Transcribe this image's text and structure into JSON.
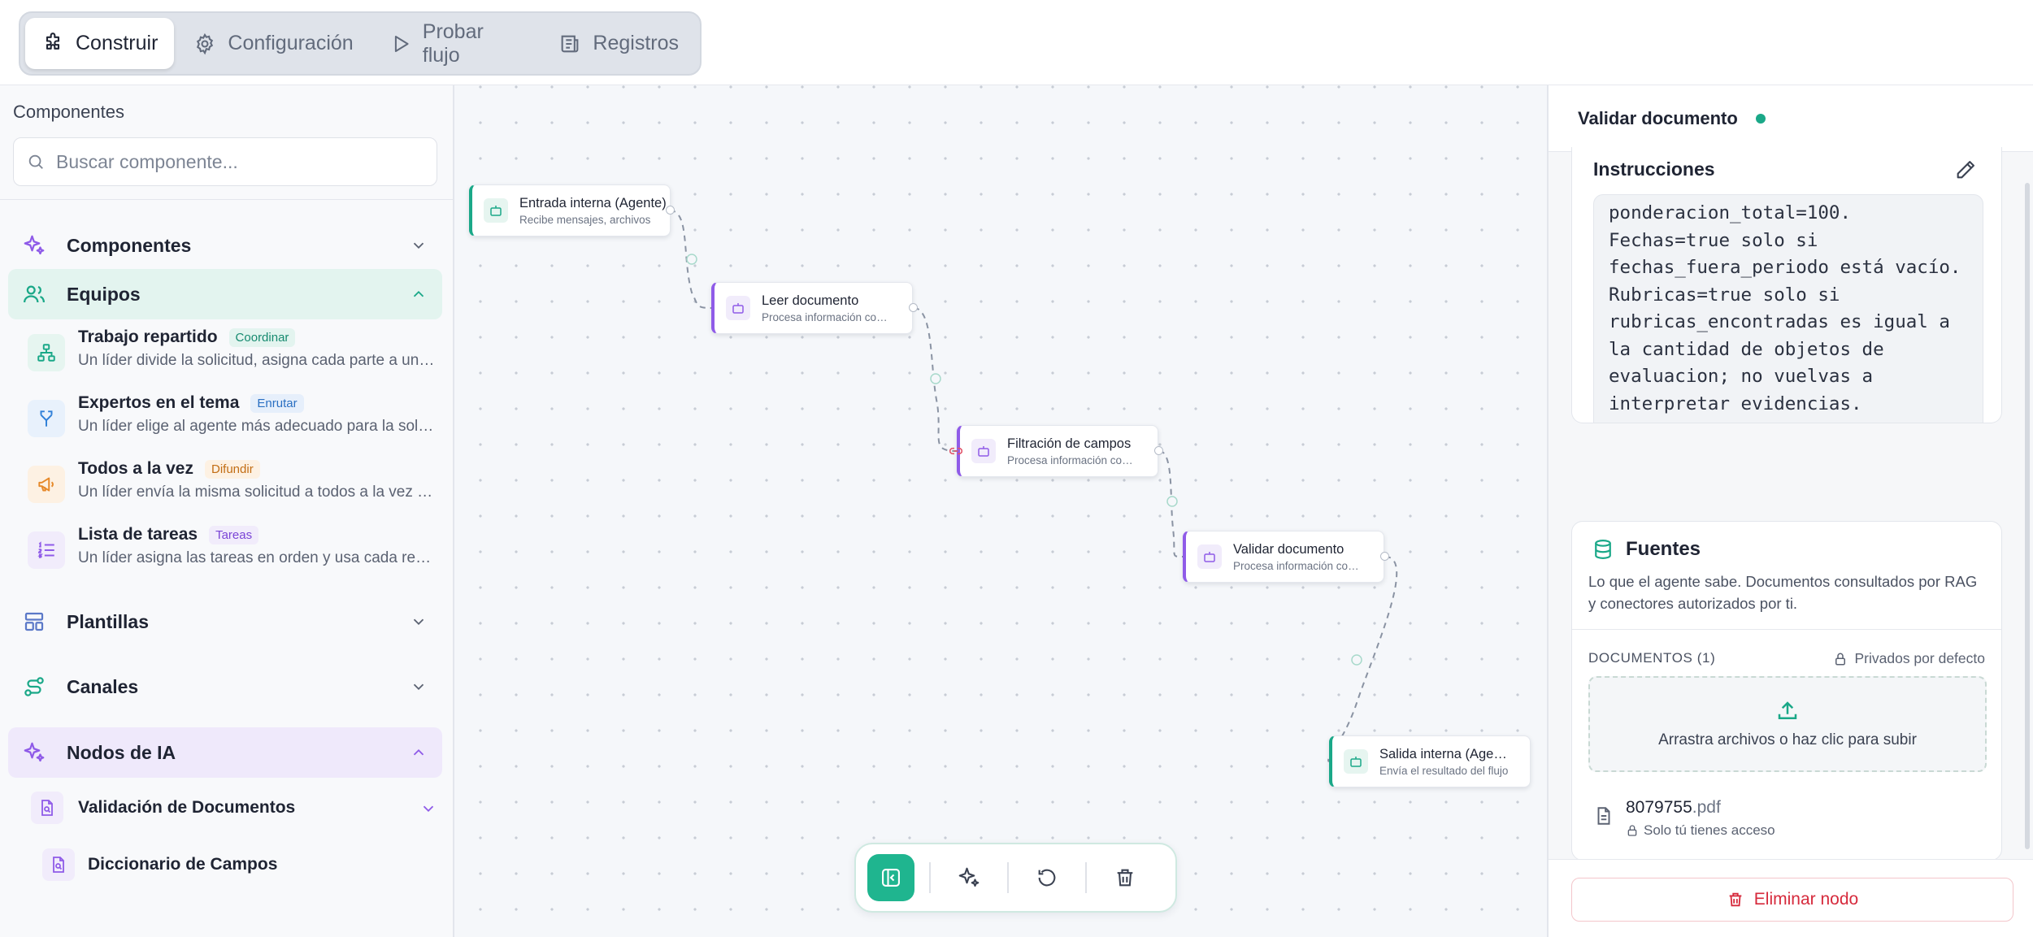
{
  "tabs": [
    {
      "label": "Construir",
      "icon": "puzzle-icon",
      "active": true
    },
    {
      "label": "Configuración",
      "icon": "gear-icon",
      "active": false
    },
    {
      "label": "Probar flujo",
      "icon": "play-icon",
      "active": false
    },
    {
      "label": "Registros",
      "icon": "logs-icon",
      "active": false
    }
  ],
  "sidebar": {
    "title": "Componentes",
    "search_placeholder": "Buscar componente...",
    "sections": {
      "componentes": "Componentes",
      "equipos": "Equipos",
      "plantillas": "Plantillas",
      "canales": "Canales",
      "nodos_ia": "Nodos de IA"
    },
    "teams": [
      {
        "name": "Trabajo repartido",
        "badge": "Coordinar",
        "desc": "Un líder divide la solicitud, asigna cada parte a un agente"
      },
      {
        "name": "Expertos en el tema",
        "badge": "Enrutar",
        "desc": "Un líder elige al agente más adecuado para la solicitud"
      },
      {
        "name": "Todos a la vez",
        "badge": "Difundir",
        "desc": "Un líder envía la misma solicitud a todos a la vez para"
      },
      {
        "name": "Lista de tareas",
        "badge": "Tareas",
        "desc": "Un líder asigna las tareas en orden y usa cada resultado"
      }
    ],
    "ia_items": [
      "Validación de Documentos",
      "Diccionario de Campos"
    ],
    "colors": {
      "teal": "#1aa888",
      "purple": "#8f5be8",
      "orange": "#e6892a",
      "blue": "#2f7fd8"
    }
  },
  "canvas": {
    "nodes": [
      {
        "title": "Entrada interna (Agente)",
        "subtitle": "Recibe mensajes, archivos",
        "kind": "teal"
      },
      {
        "title": "Leer documento",
        "subtitle": "Procesa información con IA",
        "kind": "purple"
      },
      {
        "title": "Filtración de campos",
        "subtitle": "Procesa información con IA",
        "kind": "purple"
      },
      {
        "title": "Validar documento",
        "subtitle": "Procesa información con IA",
        "kind": "purple"
      },
      {
        "title": "Salida interna (Agente)",
        "subtitle": "Envía el resultado del flujo",
        "kind": "teal"
      }
    ],
    "toolbar": [
      "collapse-panel-icon",
      "sparkles-icon",
      "reset-icon",
      "trash-icon"
    ]
  },
  "panel": {
    "title": "Validar documento",
    "status_color": "#1aa888",
    "instructions_title": "Instrucciones",
    "instructions_text": "ponderacion_total=100.\nFechas=true solo si\nfechas_fuera_periodo está vacío.\nRubricas=true solo si\nrubricas_encontradas es igual a\nla cantidad de objetos de\nevaluacion; no vuelvas a\ninterpretar evidencias.\n\n[VEREDICTO]:",
    "fuentes_title": "Fuentes",
    "fuentes_desc": "Lo que el agente sabe. Documentos consultados por RAG y conectores autorizados por ti.",
    "documents_label": "DOCUMENTOS (1)",
    "private_label": "Privados por defecto",
    "dropzone_text": "Arrastra archivos o haz clic para subir",
    "file_name": "8079755",
    "file_ext": ".pdf",
    "file_access": "Solo tú tienes acceso",
    "delete_label": "Eliminar nodo"
  }
}
